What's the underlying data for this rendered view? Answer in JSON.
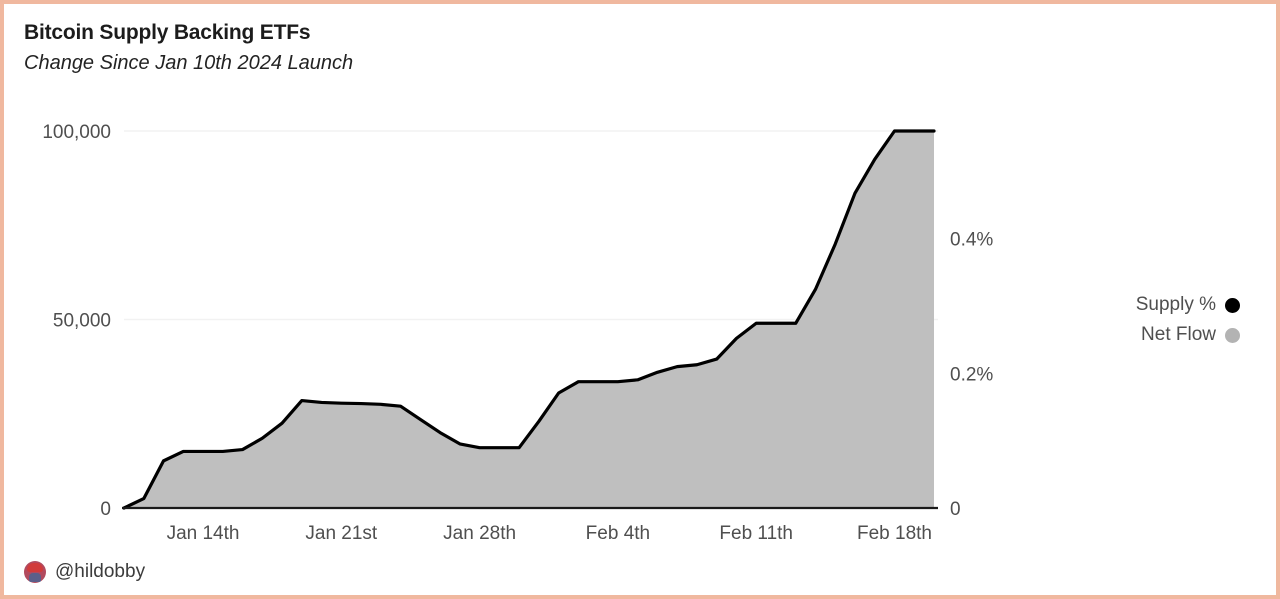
{
  "header": {
    "title": "Bitcoin Supply Backing ETFs",
    "subtitle": "Change Since Jan 10th 2024 Launch"
  },
  "credit": {
    "handle": "@hildobby",
    "avatar_icon": "user-avatar-icon"
  },
  "legend": {
    "position": "right",
    "items": [
      {
        "label": "Supply %",
        "color": "#000000",
        "marker": "circle"
      },
      {
        "label": "Net Flow",
        "color": "#b3b3b3",
        "marker": "circle"
      }
    ]
  },
  "colors": {
    "border": "#f0b89f",
    "area_fill": "#bfbfbf",
    "line": "#000000",
    "grid": "#f2f2f2",
    "axis": "#1a1a1a",
    "tick_text": "#4f4f4f"
  },
  "chart_data": {
    "type": "area",
    "title": "Bitcoin Supply Backing ETFs",
    "subtitle": "Change Since Jan 10th 2024 Launch",
    "xlabel": "",
    "ylabel": "Net Flow",
    "y2label": "Supply %",
    "grid": true,
    "ylim": [
      0,
      106000
    ],
    "y2lim": [
      0,
      0.56
    ],
    "yticks": [
      0,
      50000,
      100000
    ],
    "yticklabels": [
      "0",
      "50,000",
      "100,000"
    ],
    "y2ticks": [
      0,
      0.2,
      0.4
    ],
    "y2ticklabels": [
      "0",
      "0.2%",
      "0.4%"
    ],
    "xticklabels": [
      "Jan 14th",
      "Jan 21st",
      "Jan 28th",
      "Feb 4th",
      "Feb 11th",
      "Feb 18th"
    ],
    "xtick_dates": [
      "2024-01-14",
      "2024-01-21",
      "2024-01-28",
      "2024-02-04",
      "2024-02-11",
      "2024-02-18"
    ],
    "x_start": "2024-01-10",
    "x_end": "2024-02-20",
    "series": [
      {
        "name": "Net Flow",
        "color": "#bfbfbf",
        "x": [
          "2024-01-10",
          "2024-01-11",
          "2024-01-12",
          "2024-01-13",
          "2024-01-14",
          "2024-01-15",
          "2024-01-16",
          "2024-01-17",
          "2024-01-18",
          "2024-01-19",
          "2024-01-20",
          "2024-01-21",
          "2024-01-22",
          "2024-01-23",
          "2024-01-24",
          "2024-01-25",
          "2024-01-26",
          "2024-01-27",
          "2024-01-28",
          "2024-01-29",
          "2024-01-30",
          "2024-01-31",
          "2024-02-01",
          "2024-02-02",
          "2024-02-03",
          "2024-02-04",
          "2024-02-05",
          "2024-02-06",
          "2024-02-07",
          "2024-02-08",
          "2024-02-09",
          "2024-02-10",
          "2024-02-11",
          "2024-02-12",
          "2024-02-13",
          "2024-02-14",
          "2024-02-15",
          "2024-02-16",
          "2024-02-17",
          "2024-02-18",
          "2024-02-19",
          "2024-02-20"
        ],
        "values": [
          0,
          2500,
          12500,
          15000,
          15000,
          15000,
          15500,
          18500,
          22500,
          28500,
          28000,
          27800,
          27700,
          27500,
          27000,
          23500,
          20000,
          17000,
          16000,
          16000,
          16000,
          23000,
          30500,
          33500,
          33500,
          33500,
          34000,
          36000,
          37500,
          38000,
          39500,
          45000,
          49000,
          49000,
          49000,
          58000,
          70000,
          83500,
          92500,
          100000,
          100000,
          100000
        ]
      },
      {
        "name": "Supply %",
        "color": "#000000",
        "x": [
          "2024-01-10",
          "2024-01-11",
          "2024-01-12",
          "2024-01-13",
          "2024-01-14",
          "2024-01-15",
          "2024-01-16",
          "2024-01-17",
          "2024-01-18",
          "2024-01-19",
          "2024-01-20",
          "2024-01-21",
          "2024-01-22",
          "2024-01-23",
          "2024-01-24",
          "2024-01-25",
          "2024-01-26",
          "2024-01-27",
          "2024-01-28",
          "2024-01-29",
          "2024-01-30",
          "2024-01-31",
          "2024-02-01",
          "2024-02-02",
          "2024-02-03",
          "2024-02-04",
          "2024-02-05",
          "2024-02-06",
          "2024-02-07",
          "2024-02-08",
          "2024-02-09",
          "2024-02-10",
          "2024-02-11",
          "2024-02-12",
          "2024-02-13",
          "2024-02-14",
          "2024-02-15",
          "2024-02-16",
          "2024-02-17",
          "2024-02-18",
          "2024-02-19",
          "2024-02-20"
        ],
        "values": [
          0,
          0.013,
          0.066,
          0.079,
          0.079,
          0.079,
          0.082,
          0.098,
          0.119,
          0.151,
          0.148,
          0.147,
          0.147,
          0.145,
          0.143,
          0.124,
          0.106,
          0.09,
          0.085,
          0.085,
          0.085,
          0.122,
          0.161,
          0.177,
          0.177,
          0.177,
          0.18,
          0.19,
          0.198,
          0.201,
          0.209,
          0.238,
          0.259,
          0.259,
          0.259,
          0.307,
          0.37,
          0.442,
          0.489,
          0.529,
          0.529,
          0.529
        ]
      }
    ]
  }
}
